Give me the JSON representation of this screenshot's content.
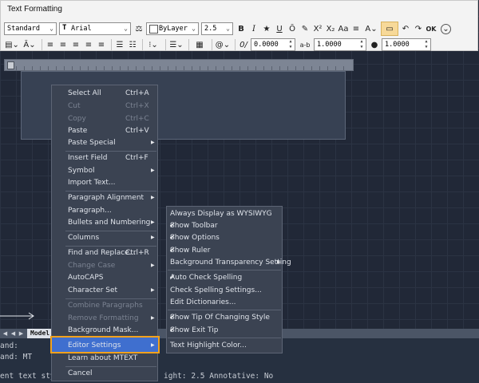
{
  "toolbar": {
    "title": "Text Formatting",
    "style": "Standard",
    "font": "Arial",
    "color": "ByLayer",
    "height": "2.5",
    "buttons_row1": [
      "B",
      "I",
      "★",
      "U",
      "Ō",
      "↶",
      "X²",
      "X₂",
      "Aa",
      "≡",
      "A",
      "≡",
      "↶",
      "↷",
      "OK",
      "⌄"
    ],
    "row2": {
      "oblique": "0.0000",
      "tracking_label": "a-b",
      "tracking": "1.0000",
      "width": "1.0000",
      "symbol": "@"
    }
  },
  "context_menu": {
    "items": [
      {
        "label": "Select All",
        "shortcut": "Ctrl+A",
        "disabled": false,
        "submenu": false
      },
      {
        "label": "Cut",
        "shortcut": "Ctrl+X",
        "disabled": true,
        "submenu": false
      },
      {
        "label": "Copy",
        "shortcut": "Ctrl+C",
        "disabled": true,
        "submenu": false
      },
      {
        "label": "Paste",
        "shortcut": "Ctrl+V",
        "disabled": false,
        "submenu": false
      },
      {
        "label": "Paste Special",
        "shortcut": "",
        "disabled": false,
        "submenu": true
      },
      {
        "label": "Insert Field",
        "shortcut": "Ctrl+F",
        "disabled": false,
        "submenu": false
      },
      {
        "label": "Symbol",
        "shortcut": "",
        "disabled": false,
        "submenu": true
      },
      {
        "label": "Import Text...",
        "shortcut": "",
        "disabled": false,
        "submenu": false
      },
      {
        "label": "Paragraph Alignment",
        "shortcut": "",
        "disabled": false,
        "submenu": true
      },
      {
        "label": "Paragraph...",
        "shortcut": "",
        "disabled": false,
        "submenu": false
      },
      {
        "label": "Bullets and Numbering",
        "shortcut": "",
        "disabled": false,
        "submenu": true
      },
      {
        "label": "Columns",
        "shortcut": "",
        "disabled": false,
        "submenu": true
      },
      {
        "label": "Find and Replace...",
        "shortcut": "Ctrl+R",
        "disabled": false,
        "submenu": false
      },
      {
        "label": "Change Case",
        "shortcut": "",
        "disabled": true,
        "submenu": true
      },
      {
        "label": "AutoCAPS",
        "shortcut": "",
        "disabled": false,
        "submenu": false
      },
      {
        "label": "Character Set",
        "shortcut": "",
        "disabled": false,
        "submenu": true
      },
      {
        "label": "Combine Paragraphs",
        "shortcut": "",
        "disabled": true,
        "submenu": false
      },
      {
        "label": "Remove Formatting",
        "shortcut": "",
        "disabled": true,
        "submenu": true
      },
      {
        "label": "Background Mask...",
        "shortcut": "",
        "disabled": false,
        "submenu": false
      },
      {
        "label": "Editor Settings",
        "shortcut": "",
        "disabled": false,
        "submenu": true
      },
      {
        "label": "Learn about MTEXT",
        "shortcut": "",
        "disabled": false,
        "submenu": false
      },
      {
        "label": "Cancel",
        "shortcut": "",
        "disabled": false,
        "submenu": false
      }
    ]
  },
  "editor_settings_menu": {
    "items": [
      {
        "label": "Always Display as WYSIWYG",
        "checked": false,
        "submenu": false
      },
      {
        "label": "Show Toolbar",
        "checked": true,
        "submenu": false
      },
      {
        "label": "Show Options",
        "checked": true,
        "submenu": false
      },
      {
        "label": "Show Ruler",
        "checked": true,
        "submenu": false
      },
      {
        "label": "Background Transparency Setting",
        "checked": false,
        "submenu": true
      },
      {
        "label": "Auto Check Spelling",
        "checked": true,
        "submenu": false
      },
      {
        "label": "Check Spelling Settings...",
        "checked": false,
        "submenu": false
      },
      {
        "label": "Edit Dictionaries...",
        "checked": false,
        "submenu": false
      },
      {
        "label": "Show Tip Of Changing Style",
        "checked": true,
        "submenu": false
      },
      {
        "label": "Show Exit Tip",
        "checked": true,
        "submenu": false
      },
      {
        "label": "Text Highlight Color...",
        "checked": false,
        "submenu": false
      }
    ]
  },
  "layout_tab": "Model",
  "command_lines": [
    "and:",
    "and: MT",
    "ent text sty",
    "ight: 2.5 Annotative: No"
  ],
  "colors": {
    "highlight_border": "#f2a21c",
    "highlight_fill": "#3f6fcf",
    "menu_bg": "#3b4352"
  }
}
